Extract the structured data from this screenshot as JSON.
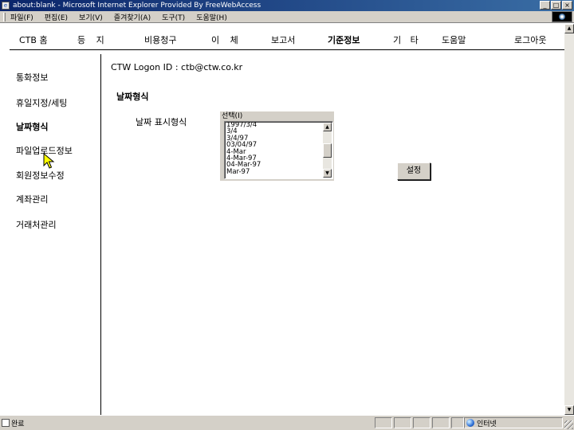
{
  "window": {
    "title": "about:blank - Microsoft Internet Explorer Provided By FreeWebAccess",
    "controls": {
      "minimize": "_",
      "maximize": "□",
      "close": "×"
    }
  },
  "menubar": {
    "items": [
      "파일(F)",
      "편집(E)",
      "보기(V)",
      "즐겨찾기(A)",
      "도구(T)",
      "도움말(H)"
    ]
  },
  "topnav": {
    "items": [
      {
        "label": "CTB 홈"
      },
      {
        "label": "등    지"
      },
      {
        "label": "비용청구"
      },
      {
        "label": "이    체"
      },
      {
        "label": "보고서"
      },
      {
        "label": "기준정보"
      },
      {
        "label": "기    타"
      },
      {
        "label": "도움말"
      },
      {
        "label": "로그아웃"
      }
    ],
    "active_index": 5
  },
  "sidebar": {
    "items": [
      {
        "label": "통화정보"
      },
      {
        "label": "휴일지정/세팅"
      },
      {
        "label": "날짜형식"
      },
      {
        "label": "파일업로드정보"
      },
      {
        "label": "회원정보수정"
      },
      {
        "label": "계좌관리"
      },
      {
        "label": "거래처관리"
      }
    ],
    "active_index": 2
  },
  "main": {
    "logon": "CTW Logon ID : ctb@ctw.co.kr",
    "section_title": "날짜형식",
    "field_label": "날짜 표시형식",
    "listbox": {
      "caption": "선택(I)",
      "options": [
        "1997/3/4",
        "3/4",
        "3/4/97",
        "03/04/97",
        "4-Mar",
        "4-Mar-97",
        "04-Mar-97",
        "Mar-97"
      ]
    },
    "set_button": "설정"
  },
  "statusbar": {
    "status": "완료",
    "zone": "인터넷"
  },
  "icons": {
    "app": "ie-page-icon",
    "pointer": "mouse-cursor-icon",
    "zone": "internet-zone-icon"
  }
}
